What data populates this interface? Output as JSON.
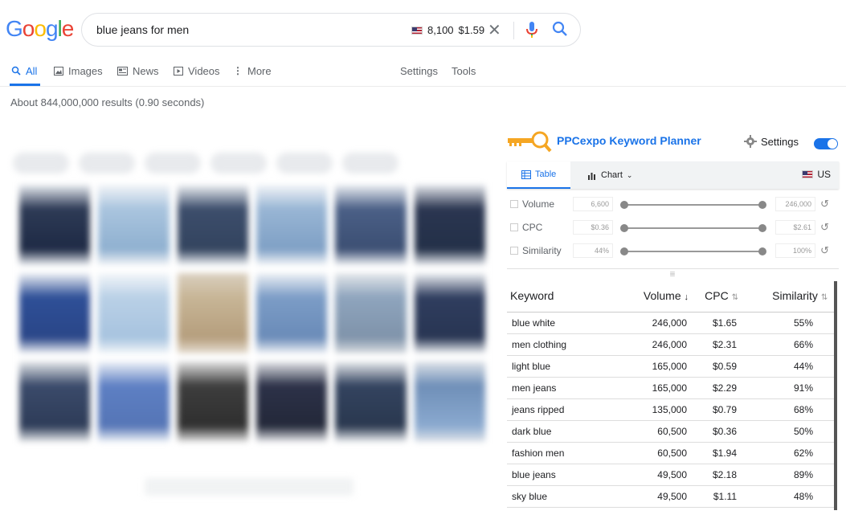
{
  "search": {
    "query": "blue jeans for men",
    "ext_volume": "8,100",
    "ext_cpc": "$1.59"
  },
  "tabs": [
    {
      "label": "All",
      "icon": "search-icon",
      "active": true
    },
    {
      "label": "Images",
      "icon": "image-icon"
    },
    {
      "label": "News",
      "icon": "news-icon"
    },
    {
      "label": "Videos",
      "icon": "video-icon"
    },
    {
      "label": "More",
      "icon": "more-vert-icon"
    }
  ],
  "tools": {
    "settings": "Settings",
    "tools": "Tools"
  },
  "results_stats": "About 844,000,000 results (0.90 seconds)",
  "extension": {
    "title": "PPCexpo Keyword Planner",
    "settings_label": "Settings",
    "toggle_on": true,
    "tab_table": "Table",
    "tab_chart": "Chart",
    "country": "US",
    "filters": [
      {
        "label": "Volume",
        "min": "6,600",
        "max": "246,000"
      },
      {
        "label": "CPC",
        "min": "$0.36",
        "max": "$2.61"
      },
      {
        "label": "Similarity",
        "min": "44%",
        "max": "100%"
      }
    ],
    "columns": {
      "keyword": "Keyword",
      "volume": "Volume",
      "cpc": "CPC",
      "similarity": "Similarity"
    },
    "rows": [
      {
        "keyword": "blue white",
        "volume": "246,000",
        "cpc": "$1.65",
        "similarity": "55%"
      },
      {
        "keyword": "men clothing",
        "volume": "246,000",
        "cpc": "$2.31",
        "similarity": "66%"
      },
      {
        "keyword": "light blue",
        "volume": "165,000",
        "cpc": "$0.59",
        "similarity": "44%"
      },
      {
        "keyword": "men jeans",
        "volume": "165,000",
        "cpc": "$2.29",
        "similarity": "91%"
      },
      {
        "keyword": "jeans ripped",
        "volume": "135,000",
        "cpc": "$0.79",
        "similarity": "68%"
      },
      {
        "keyword": "dark blue",
        "volume": "60,500",
        "cpc": "$0.36",
        "similarity": "50%"
      },
      {
        "keyword": "fashion men",
        "volume": "60,500",
        "cpc": "$1.94",
        "similarity": "62%"
      },
      {
        "keyword": "blue jeans",
        "volume": "49,500",
        "cpc": "$2.18",
        "similarity": "89%"
      },
      {
        "keyword": "sky blue",
        "volume": "49,500",
        "cpc": "$1.11",
        "similarity": "48%"
      }
    ]
  },
  "colors": {
    "accent": "#1a73e8",
    "logo": [
      "#4285f4",
      "#ea4335",
      "#fbbc05",
      "#4285f4",
      "#34a853",
      "#ea4335"
    ]
  }
}
